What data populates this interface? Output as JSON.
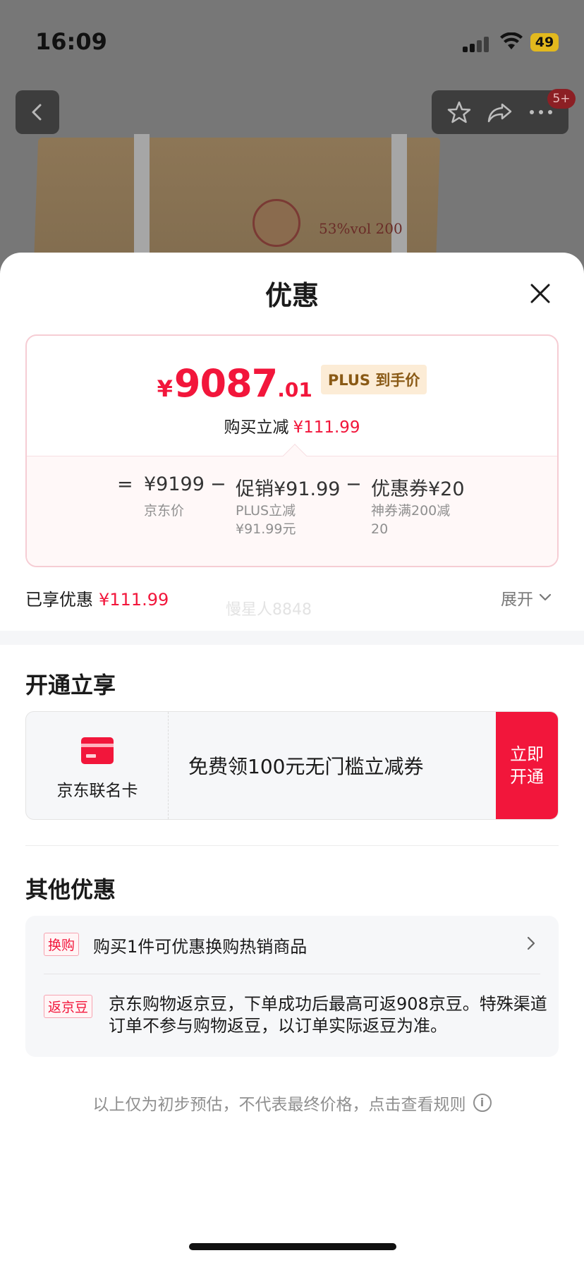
{
  "status_bar": {
    "time": "16:09",
    "battery": "49"
  },
  "nav": {
    "badge": "5+"
  },
  "background": {
    "product_label": "53%vol 200"
  },
  "sheet": {
    "title": "优惠",
    "price": {
      "currency": "¥",
      "integer": "9087",
      "decimal": ".01",
      "tag": "PLUS 到手价",
      "reduce_label": "购买立减",
      "reduce_amount": "¥111.99"
    },
    "formula": {
      "eq": "=",
      "base_value": "¥9199",
      "base_label": "京东价",
      "minus1": "−",
      "promo_value": "促销¥91.99",
      "promo_sub1": "PLUS立减",
      "promo_sub2": "¥91.99元",
      "minus2": "−",
      "coupon_value": "优惠券¥20",
      "coupon_sub1": "神券满200减",
      "coupon_sub2": "20"
    },
    "enjoyed_label": "已享优惠",
    "enjoyed_amount": "¥111.99",
    "expand_label": "展开",
    "watermark": "慢星人8848"
  },
  "open_section": {
    "title": "开通立享",
    "card_name": "京东联名卡",
    "offer_text": "免费领100元无门槛立减券",
    "button": "立即开通"
  },
  "other_section": {
    "title": "其他优惠",
    "items": [
      {
        "tag": "换购",
        "text": "购买1件可优惠换购热销商品"
      },
      {
        "tag": "返京豆",
        "text": "京东购物返京豆，下单成功后最高可返908京豆。特殊渠道订单不参与购物返豆，以订单实际返豆为准。"
      }
    ]
  },
  "footer_note": "以上仅为初步预估，不代表最终价格，点击查看规则",
  "colors": {
    "accent": "#f2163b",
    "plus_tag_bg": "#fcecd6",
    "plus_tag_text": "#8a5a16"
  }
}
